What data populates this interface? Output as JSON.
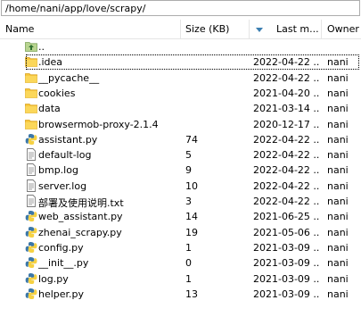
{
  "path": "/home/nani/app/love/scrapy/",
  "columns": {
    "name": "Name",
    "size": "Size (KB)",
    "modified": "Last m...",
    "owner": "Owner"
  },
  "rows": [
    {
      "name": "..",
      "size": "",
      "date": "",
      "owner": "",
      "icon": "parent-folder-icon"
    },
    {
      "name": ".idea",
      "size": "",
      "date": "2022-04-22 ...",
      "owner": "nani",
      "icon": "folder-icon"
    },
    {
      "name": "__pycache__",
      "size": "",
      "date": "2022-04-22 ...",
      "owner": "nani",
      "icon": "folder-icon"
    },
    {
      "name": "cookies",
      "size": "",
      "date": "2021-04-20 ...",
      "owner": "nani",
      "icon": "folder-icon"
    },
    {
      "name": "data",
      "size": "",
      "date": "2021-03-14 ...",
      "owner": "nani",
      "icon": "folder-icon"
    },
    {
      "name": "browsermob-proxy-2.1.4",
      "size": "",
      "date": "2020-12-17 ...",
      "owner": "nani",
      "icon": "folder-icon"
    },
    {
      "name": "assistant.py",
      "size": "74",
      "date": "2022-04-22 ...",
      "owner": "nani",
      "icon": "python-file-icon"
    },
    {
      "name": "default-log",
      "size": "5",
      "date": "2022-04-22 ...",
      "owner": "nani",
      "icon": "text-file-icon"
    },
    {
      "name": "bmp.log",
      "size": "9",
      "date": "2022-04-22 ...",
      "owner": "nani",
      "icon": "text-file-icon"
    },
    {
      "name": "server.log",
      "size": "10",
      "date": "2022-04-22 ...",
      "owner": "nani",
      "icon": "text-file-icon"
    },
    {
      "name": "部署及使用说明.txt",
      "size": "3",
      "date": "2022-04-22 ...",
      "owner": "nani",
      "icon": "text-file-icon"
    },
    {
      "name": "web_assistant.py",
      "size": "14",
      "date": "2021-06-25 ...",
      "owner": "nani",
      "icon": "python-file-icon"
    },
    {
      "name": "zhenai_scrapy.py",
      "size": "19",
      "date": "2021-05-06 ...",
      "owner": "nani",
      "icon": "python-file-icon"
    },
    {
      "name": "config.py",
      "size": "1",
      "date": "2021-03-09 ...",
      "owner": "nani",
      "icon": "python-file-icon"
    },
    {
      "name": "__init__.py",
      "size": "0",
      "date": "2021-03-09 ...",
      "owner": "nani",
      "icon": "python-file-icon"
    },
    {
      "name": "log.py",
      "size": "1",
      "date": "2021-03-09 ...",
      "owner": "nani",
      "icon": "python-file-icon"
    },
    {
      "name": "helper.py",
      "size": "13",
      "date": "2021-03-09 ...",
      "owner": "nani",
      "icon": "python-file-icon"
    }
  ],
  "colors": {
    "folder": "#f8c63a",
    "python_blue": "#3b77a8",
    "python_yellow": "#f6d142",
    "sort_arrow": "#3c7fb1"
  }
}
